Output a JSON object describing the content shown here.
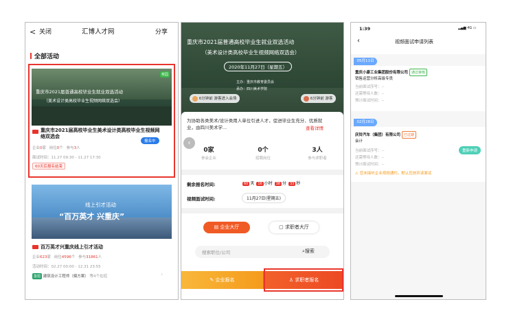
{
  "panel1": {
    "nav": {
      "back": "<",
      "close": "关闭",
      "title": "汇博人才网",
      "share": "分享"
    },
    "section_title": "全部活动",
    "event1": {
      "badge": "校园",
      "hero_line1": "重庆市2021届普通高校毕业生就业双选活动",
      "hero_line2": "（美术设计类高校毕业生视频网络双选会）",
      "title": "重庆市2021届高校毕业生美术设计类高校毕业生视频网络双选会",
      "status": "报名中",
      "stats_prefix1": "企业",
      "companies": "0",
      "stats_unit1": "家",
      "stats_prefix2": "岗位",
      "jobs": "0",
      "stats_unit2": "个",
      "stats_prefix3": "参与",
      "participants": "3",
      "stats_unit3": "人",
      "time": "面试时间：11.27 09:30 - 11.27 17:30",
      "deadline": "60天后报名结束"
    },
    "event2": {
      "hero_line1": "线上引才活动",
      "hero_line2": "“百万英才 兴重庆”",
      "title": "百万英才兴重庆线上引才活动",
      "stats_prefix1": "企业",
      "companies": "623",
      "stats_unit1": "家",
      "stats_prefix2": "岗位",
      "jobs": "4596",
      "stats_unit2": "个",
      "stats_prefix3": "参与",
      "participants": "31861",
      "stats_unit3": "人",
      "time": "活动时间：02.27 00:00 - 12.31 23:55",
      "tag": "急招",
      "job": "建筑设计工程师（偏方案）",
      "job_more": "等4个在招"
    }
  },
  "panel2": {
    "hero_title": "重庆市2021届普通高校毕业生就业双选活动",
    "hero_sub": "（美术设计类高校毕业生视频网络双选会）",
    "hero_date": "2020年11月27日（星期五）",
    "organizer1": "主办：重庆市教育委员会",
    "organizer2": "承办：四川美术学院",
    "ticker1": "6分钟前 游客进入会场",
    "ticker2": "6分钟前 游客",
    "desc": "为协助各类美术/设计类用人单位引进人才，促进毕业生充分、优质就业，由四川美术学...",
    "desc_link": "查看详情",
    "stats": [
      {
        "value": "0家",
        "label": "参会企业"
      },
      {
        "value": "0个",
        "label": "招聘岗位"
      },
      {
        "value": "3人",
        "label": "参与求职者"
      }
    ],
    "remain_label": "剩余报名时间:",
    "countdown": {
      "days": "60",
      "d": "天",
      "hours": "16",
      "h": "小时",
      "mins": "38",
      "m": "分",
      "secs": "33",
      "s": "秒"
    },
    "interview_label": "视频面试时间:",
    "interview_date": "11月27日(星期五)",
    "tab_company": "企业大厅",
    "tab_seeker": "求职者大厅",
    "search_placeholder": "搜索职位/公司",
    "search_btn": "搜索",
    "btn_company": "企业报名",
    "btn_seeker": "求职者报名"
  },
  "panel3": {
    "status_time": "1:39",
    "status_net": "4G",
    "title": "视频面试申请列表",
    "items": [
      {
        "date": "05月11日",
        "company": "重庆小康工业集团股份有限公司",
        "tag": "通过审核",
        "position": "销售运营分析高级专员",
        "f1": "当前面试序号：--",
        "f2": "还需等待人数：--",
        "f3": "预计面试时间：--"
      },
      {
        "date": "02月28日",
        "company": "庆铃汽车（集团）有限公司",
        "tag": "已过期",
        "position": "会计",
        "f1": "当前面试序号：--",
        "f2": "还需等待人数：--",
        "f3": "预计面试时间：--",
        "btn": "重新申请",
        "warn": "您未接听企业视频通约，默认您放弃该面试"
      }
    ]
  }
}
